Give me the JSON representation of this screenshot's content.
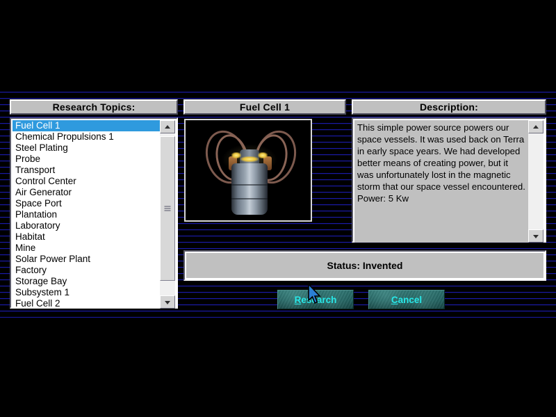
{
  "panels": {
    "topics_title": "Research Topics:",
    "preview_title": "Fuel Cell 1",
    "description_title": "Description:"
  },
  "topics": {
    "selected": "Fuel Cell 1",
    "items": [
      "Fuel Cell 1",
      "Chemical Propulsions 1",
      "Steel Plating",
      "Probe",
      "Transport",
      "Control Center",
      "Air Generator",
      "Space Port",
      "Plantation",
      "Laboratory",
      "Habitat",
      "Mine",
      "Solar Power Plant",
      "Factory",
      "Storage Bay",
      "Subsystem 1",
      "Fuel Cell 2"
    ]
  },
  "description": {
    "text": "This simple power source powers our space vessels.  It was used back on Terra in early space years. We had developed better means of creating power, but it was unfortunately lost in the magnetic storm that our space vessel encountered.  Power: 5 Kw"
  },
  "status": {
    "text": "Status: Invented"
  },
  "buttons": {
    "research": {
      "accel": "R",
      "rest": "esearch"
    },
    "cancel": {
      "accel": "C",
      "rest": "ancel"
    }
  },
  "colors": {
    "selection_blue": "#2f9ade",
    "panel_face": "#c0c0c0",
    "button_teal": "#1d5a58",
    "button_text_cyan": "#28e8e8",
    "scanline_blue": "#1a1aa8",
    "backdrop": "#000000"
  }
}
